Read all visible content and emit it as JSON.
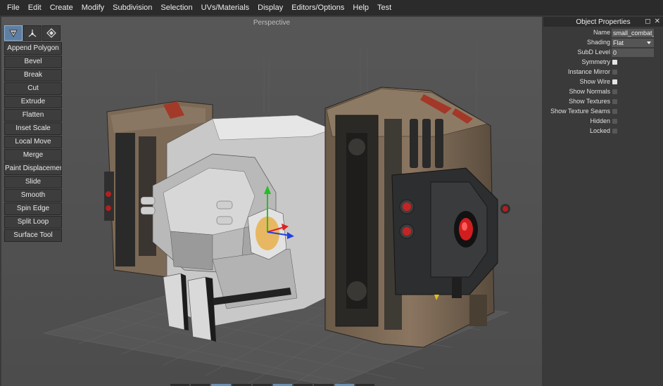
{
  "menubar": {
    "items": [
      "File",
      "Edit",
      "Create",
      "Modify",
      "Subdivision",
      "Selection",
      "UVs/Materials",
      "Display",
      "Editors/Options",
      "Help",
      "Test"
    ]
  },
  "viewport": {
    "title": "Perspective"
  },
  "toolbar": {
    "modes": [
      {
        "icon": "object-mode-icon",
        "active": true
      },
      {
        "icon": "vertex-mode-icon",
        "active": false
      },
      {
        "icon": "face-mode-icon",
        "active": false
      }
    ],
    "tools": [
      "Append Polygon",
      "Bevel",
      "Break",
      "Cut",
      "Extrude",
      "Flatten",
      "Inset Scale",
      "Local Move",
      "Merge",
      "Paint Displacement",
      "Slide",
      "Smooth",
      "Spin Edge",
      "Split Loop",
      "Surface Tool"
    ]
  },
  "panel": {
    "title": "Object Properties",
    "name": {
      "label": "Name",
      "value": "small_combat_d"
    },
    "shading": {
      "label": "Shading",
      "value": "Flat"
    },
    "subd": {
      "label": "SubD Level",
      "value": "0"
    },
    "checks": [
      {
        "label": "Symmetry",
        "checked": true
      },
      {
        "label": "Instance Mirror",
        "checked": false
      },
      {
        "label": "Show Wire",
        "checked": true
      },
      {
        "label": "Show Normals",
        "checked": false
      },
      {
        "label": "Show Textures",
        "checked": false
      },
      {
        "label": "Show Texture Seams",
        "checked": false
      },
      {
        "label": "Hidden",
        "checked": false
      },
      {
        "label": "Locked",
        "checked": false
      }
    ]
  },
  "colors": {
    "menubar": "#2b2b2b",
    "viewport": "#545454",
    "panel": "#3a3a3a",
    "accent": "#5d7fa3",
    "gizmo_x": "#e02020",
    "gizmo_y": "#22c022",
    "gizmo_z": "#2040e0",
    "pivot": "#e8b04a"
  }
}
